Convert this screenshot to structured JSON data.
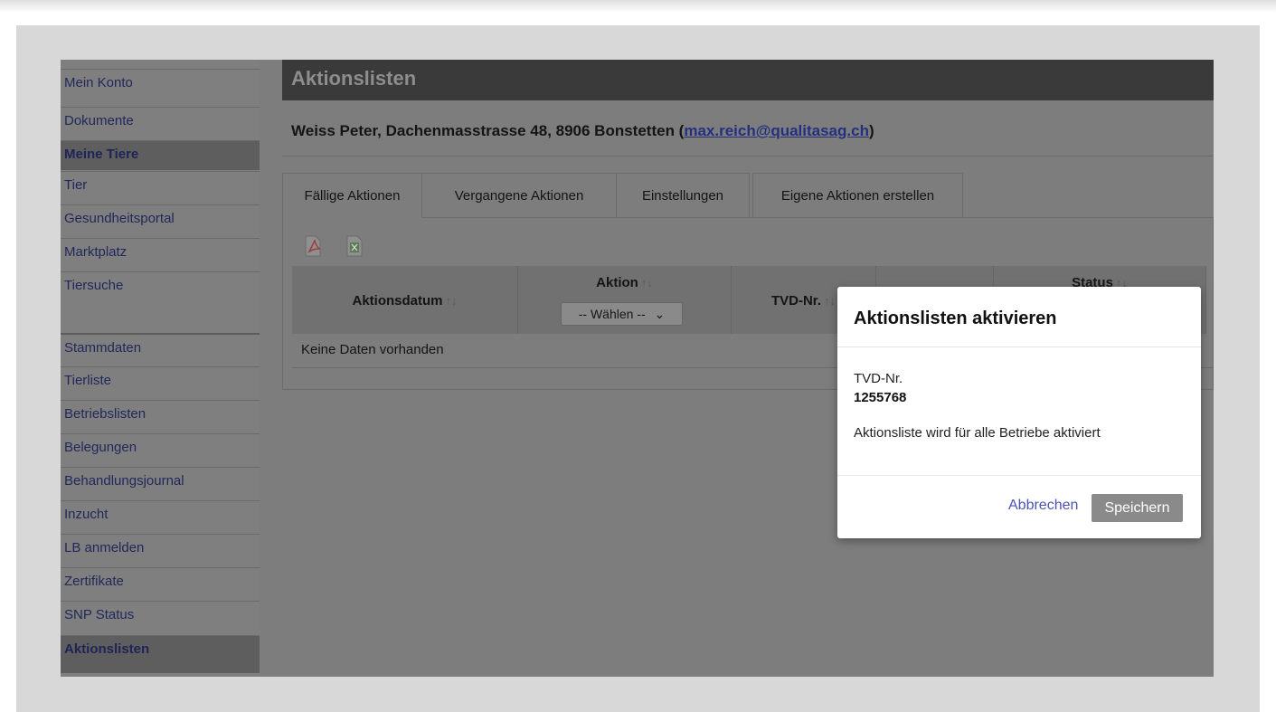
{
  "sidebar": {
    "items": [
      {
        "label": "Mein Konto",
        "active": false
      },
      {
        "label": "Dokumente",
        "active": false
      },
      {
        "label": "Meine Tiere",
        "active": true
      },
      {
        "label": "Tier",
        "active": false
      },
      {
        "label": "Gesundheitsportal",
        "active": false
      },
      {
        "label": "Marktplatz",
        "active": false
      },
      {
        "label": "Tiersuche",
        "active": false
      },
      {
        "label": "Stammdaten",
        "active": false
      },
      {
        "label": "Tierliste",
        "active": false
      },
      {
        "label": "Betriebslisten",
        "active": false
      },
      {
        "label": "Belegungen",
        "active": false
      },
      {
        "label": "Behandlungsjournal",
        "active": false
      },
      {
        "label": "Inzucht",
        "active": false
      },
      {
        "label": "LB anmelden",
        "active": false
      },
      {
        "label": "Zertifikate",
        "active": false
      },
      {
        "label": "SNP Status",
        "active": false
      },
      {
        "label": "Aktionslisten",
        "active": true
      }
    ]
  },
  "main": {
    "title": "Aktionslisten",
    "owner_text": "Weiss Peter, Dachenmasstrasse 48, 8906 Bonstetten (",
    "owner_email": "max.reich@qualitasag.ch",
    "owner_close": ")",
    "tabs": [
      {
        "label": "Fällige Aktionen",
        "active": true
      },
      {
        "label": "Vergangene Aktionen",
        "active": false
      },
      {
        "label": "Einstellungen",
        "active": false
      },
      {
        "label": "Eigene Aktionen erstellen",
        "active": false
      }
    ],
    "table": {
      "col_date": "Aktionsdatum",
      "col_action": "Aktion",
      "action_select": "-- Wählen --",
      "col_tvd": "TVD-Nr.",
      "col_status": "Status",
      "sort_glyph": "↑↓",
      "empty_text": "Keine Daten vorhanden"
    }
  },
  "modal": {
    "title": "Aktionslisten aktivieren",
    "tvd_label": "TVD-Nr.",
    "tvd_value": "1255768",
    "note": "Aktionsliste wird für alle Betriebe aktiviert",
    "cancel_label": "Abbrechen",
    "save_label": "Speichern"
  }
}
